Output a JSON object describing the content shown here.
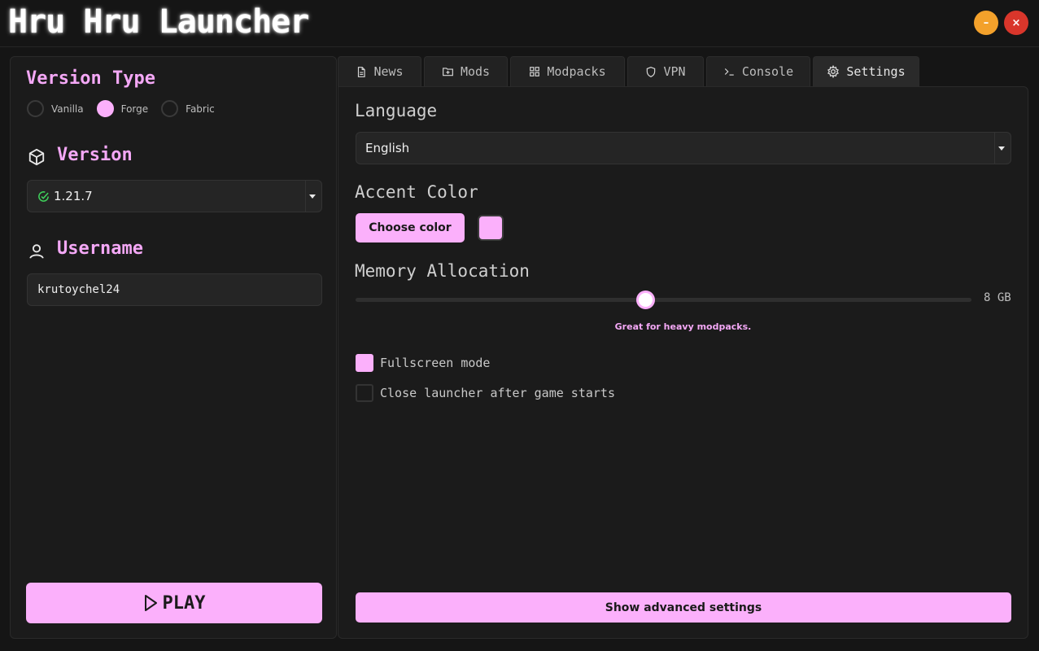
{
  "app": {
    "title": "Hru Hru Launcher",
    "minimize_glyph": "–",
    "close_glyph": "×"
  },
  "colors": {
    "accent": "#fbb0fb",
    "background": "#151515",
    "panel": "#1b1b1b"
  },
  "left": {
    "version_type_title": "Version Type",
    "version_types": [
      {
        "label": "Vanilla",
        "selected": false
      },
      {
        "label": "Forge",
        "selected": true
      },
      {
        "label": "Fabric",
        "selected": false
      }
    ],
    "version_title": "Version",
    "version_icon": "cube-icon",
    "version_selected": "1.21.7",
    "version_status_icon": "check-circle-icon",
    "username_title": "Username",
    "username_icon": "user-icon",
    "username_value": "krutoychel24",
    "play_label": "PLAY",
    "play_icon": "play-icon"
  },
  "tabs": [
    {
      "label": "News",
      "icon": "document-icon",
      "active": false
    },
    {
      "label": "Mods",
      "icon": "folder-plus-icon",
      "active": false
    },
    {
      "label": "Modpacks",
      "icon": "grid-icon",
      "active": false
    },
    {
      "label": "VPN",
      "icon": "shield-icon",
      "active": false
    },
    {
      "label": "Console",
      "icon": "terminal-icon",
      "active": false
    },
    {
      "label": "Settings",
      "icon": "gear-icon",
      "active": true
    }
  ],
  "settings": {
    "language_label": "Language",
    "language_value": "English",
    "accent_label": "Accent Color",
    "choose_color_label": "Choose color",
    "memory_label": "Memory Allocation",
    "memory_value": "8 GB",
    "memory_fraction": 0.47,
    "memory_hint": "Great for heavy modpacks.",
    "fullscreen_label": "Fullscreen mode",
    "fullscreen_checked": true,
    "close_after_label": "Close launcher after game starts",
    "close_after_checked": false,
    "advanced_label": "Show advanced settings"
  }
}
